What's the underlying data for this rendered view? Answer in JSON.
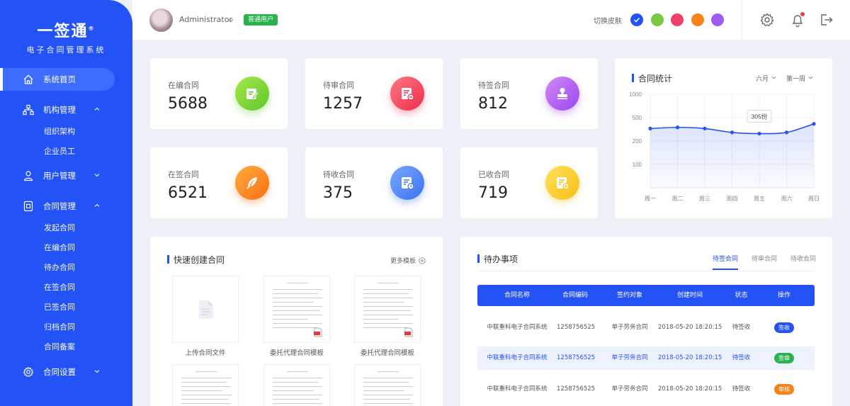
{
  "brand": {
    "name": "一签通",
    "reg": "®",
    "subtitle": "电子合同管理系统"
  },
  "sidebar": {
    "items": [
      {
        "label": "系统首页",
        "icon": "home-icon",
        "active": true
      },
      {
        "label": "机构管理",
        "icon": "org-icon",
        "expanded": true,
        "children": [
          "组织架构",
          "企业员工"
        ]
      },
      {
        "label": "用户管理",
        "icon": "user-icon",
        "expanded": false
      },
      {
        "label": "合同管理",
        "icon": "contract-icon",
        "expanded": true,
        "children": [
          "发起合同",
          "在编合同",
          "待办合同",
          "在签合同",
          "已签合同",
          "归档合同",
          "合同备案"
        ]
      },
      {
        "label": "合同设置",
        "icon": "gear-icon",
        "expanded": false
      }
    ]
  },
  "header": {
    "username": "Administrator",
    "role_badge": "普通用户",
    "skin_label": "切换皮肤",
    "skins": [
      "#2352f5",
      "#7ac943",
      "#f0406a",
      "#f7821b",
      "#a05cf0"
    ]
  },
  "stats": [
    {
      "label": "在编合同",
      "value": "5688",
      "icon": "edit-doc-icon",
      "colors": [
        "#a6e84d",
        "#5fc72a"
      ]
    },
    {
      "label": "待审合同",
      "value": "1257",
      "icon": "review-doc-icon",
      "colors": [
        "#ff7782",
        "#ee2e4a"
      ]
    },
    {
      "label": "待签合同",
      "value": "812",
      "icon": "stamp-icon",
      "colors": [
        "#d28af7",
        "#9a45f0"
      ]
    },
    {
      "label": "在签合同",
      "value": "6521",
      "icon": "feather-pen-icon",
      "colors": [
        "#ffac3d",
        "#fb6f12"
      ]
    },
    {
      "label": "待收合同",
      "value": "375",
      "icon": "clock-doc-icon",
      "colors": [
        "#7aa6ff",
        "#3c74f0"
      ]
    },
    {
      "label": "已收合同",
      "value": "719",
      "icon": "received-doc-icon",
      "colors": [
        "#ffe25a",
        "#f8be15"
      ]
    }
  ],
  "contract_chart": {
    "title": "合同统计",
    "dropdowns": [
      "六月",
      "第一周"
    ],
    "tooltip": "305份"
  },
  "chart_data": {
    "type": "area",
    "title": "合同统计",
    "categories": [
      "周一",
      "周二",
      "周三",
      "周四",
      "周五",
      "周六",
      "周日"
    ],
    "values": [
      360,
      375,
      360,
      310,
      295,
      310,
      420
    ],
    "yticks": [
      100,
      200,
      500,
      1000
    ],
    "ylim": [
      0,
      1000
    ],
    "annotation": "305份",
    "grid": true
  },
  "quick_create": {
    "title": "快速创建合同",
    "more_label": "更多模板",
    "templates": [
      {
        "label": "上传合同文件",
        "kind": "upload"
      },
      {
        "label": "委托代理合同模板",
        "kind": "doc"
      },
      {
        "label": "委托代理合同模板",
        "kind": "doc"
      },
      {
        "label": "",
        "kind": "doc"
      },
      {
        "label": "",
        "kind": "doc"
      },
      {
        "label": "",
        "kind": "doc"
      }
    ]
  },
  "todo": {
    "title": "待办事项",
    "tabs": [
      {
        "label": "待签合同",
        "active": true
      },
      {
        "label": "待审合同",
        "active": false
      },
      {
        "label": "待收合同",
        "active": false
      }
    ],
    "columns": [
      "合同名称",
      "合同编码",
      "签约对象",
      "创建时间",
      "状态",
      "操作"
    ],
    "rows": [
      {
        "cells": [
          "中联重科电子合同系统",
          "1258756525",
          "单子劳务合同",
          "2018-05-20 18:20:15",
          "待签收"
        ],
        "action": "签收",
        "action_color": "#2352f5",
        "highlight": false
      },
      {
        "cells": [
          "中联重科电子合同系统",
          "1258756525",
          "单子劳务合同",
          "2018-05-20 18:20:15",
          "待签收"
        ],
        "action": "签章",
        "action_color": "#2bb24c",
        "highlight": true
      },
      {
        "cells": [
          "中联重科电子合同系统",
          "1258756525",
          "单子劳务合同",
          "2018-05-20 18:20:15",
          "待签收"
        ],
        "action": "审核",
        "action_color": "#f7821b",
        "highlight": false
      }
    ]
  }
}
